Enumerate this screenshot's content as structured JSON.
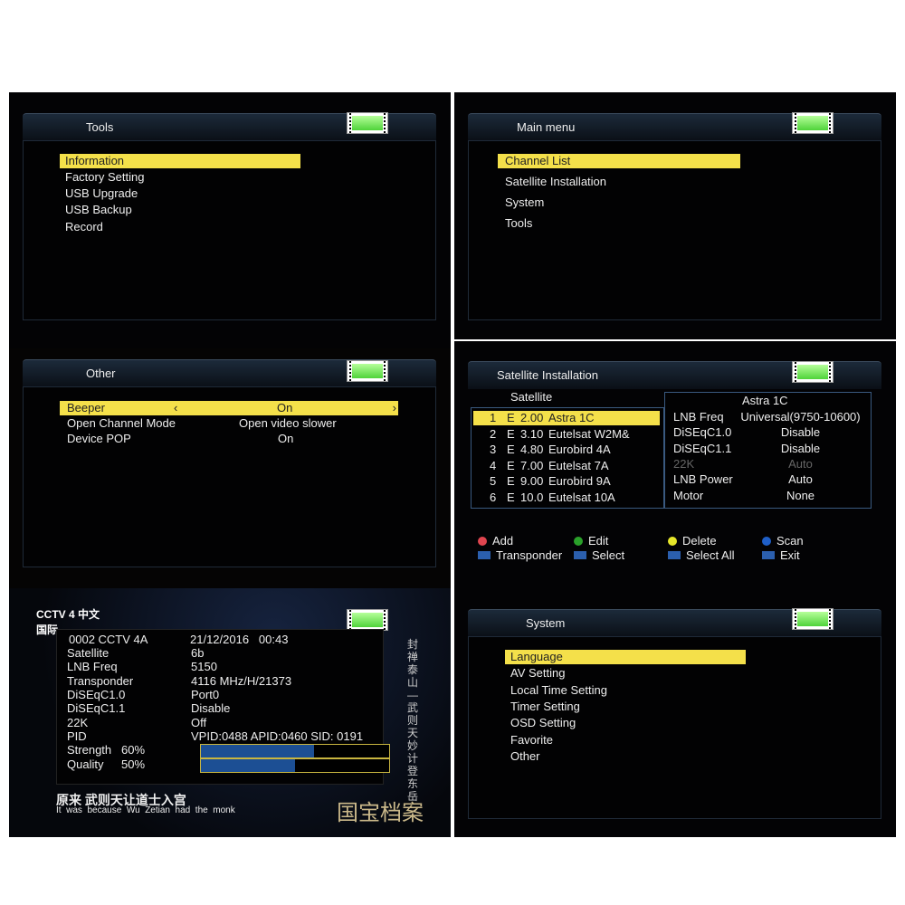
{
  "tools": {
    "title": "Tools",
    "items": [
      "Information",
      "Factory Setting",
      "USB Upgrade",
      "USB Backup",
      "Record"
    ]
  },
  "other": {
    "title": "Other",
    "rows": [
      {
        "label": "Beeper",
        "value": "On"
      },
      {
        "label": "Open Channel Mode",
        "value": "Open video slower"
      },
      {
        "label": "Device POP",
        "value": "On"
      }
    ]
  },
  "info": {
    "logo": "CCTV 4 中文国际",
    "channel": "0002  CCTV 4A",
    "datetime": "21/12/2016   00:43",
    "rows": [
      {
        "label": "Satellite",
        "value": "6b"
      },
      {
        "label": "LNB Freq",
        "value": "5150"
      },
      {
        "label": "Transponder",
        "value": "4116 MHz/H/21373"
      },
      {
        "label": "DiSEqC1.0",
        "value": "Port0"
      },
      {
        "label": "DiSEqC1.1",
        "value": "Disable"
      },
      {
        "label": "22K",
        "value": "Off"
      },
      {
        "label": "PID",
        "value": "VPID:0488 APID:0460 SID: 0191"
      }
    ],
    "strength_label": "Strength",
    "strength": "60%",
    "strength_value": 60,
    "quality_label": "Quality",
    "quality": "50%",
    "quality_value": 50,
    "subtitle_cn": "原来 武则天让道士入宫",
    "subtitle_en": "It  was  because  Wu  Zetian  had  the  monk",
    "side_text": "封禅泰山—武则天妙计登东岳",
    "watermark": "国宝档案"
  },
  "main": {
    "title": "Main menu",
    "items": [
      "Channel List",
      "Satellite Installation",
      "System",
      "Tools"
    ]
  },
  "sat": {
    "title": "Satellite Installation",
    "list_header": "Satellite",
    "list": [
      {
        "n": "1",
        "d": "E",
        "p": "2.00",
        "name": "Astra 1C"
      },
      {
        "n": "2",
        "d": "E",
        "p": "3.10",
        "name": "Eutelsat W2M&"
      },
      {
        "n": "3",
        "d": "E",
        "p": "4.80",
        "name": "Eurobird 4A"
      },
      {
        "n": "4",
        "d": "E",
        "p": "7.00",
        "name": "Eutelsat 7A"
      },
      {
        "n": "5",
        "d": "E",
        "p": "9.00",
        "name": "Eurobird 9A"
      },
      {
        "n": "6",
        "d": "E",
        "p": "10.0",
        "name": "Eutelsat 10A"
      }
    ],
    "detail_title": "Astra 1C",
    "detail": [
      {
        "label": "LNB Freq",
        "value": "Universal(9750-10600)"
      },
      {
        "label": "DiSEqC1.0",
        "value": "Disable"
      },
      {
        "label": "DiSEqC1.1",
        "value": "Disable"
      },
      {
        "label": "22K",
        "value": "Auto"
      },
      {
        "label": "LNB Power",
        "value": "Auto"
      },
      {
        "label": "Motor",
        "value": "None"
      }
    ],
    "keys": [
      {
        "label": "Add",
        "color": "#e0454f"
      },
      {
        "label": "Edit",
        "color": "#2aa02a"
      },
      {
        "label": "Delete",
        "color": "#e6e62a"
      },
      {
        "label": "Scan",
        "color": "#1f5fc8"
      },
      {
        "label": "Transponder"
      },
      {
        "label": "Select"
      },
      {
        "label": "Select All"
      },
      {
        "label": "Exit"
      }
    ]
  },
  "system": {
    "title": "System",
    "items": [
      "Language",
      "AV Setting",
      "Local Time Setting",
      "Timer Setting",
      "OSD Setting",
      "Favorite",
      "Other"
    ]
  },
  "colors": {
    "highlight": "#f4e04a",
    "bar_fill": "#1c4f94",
    "battery": "#6fe24d"
  }
}
